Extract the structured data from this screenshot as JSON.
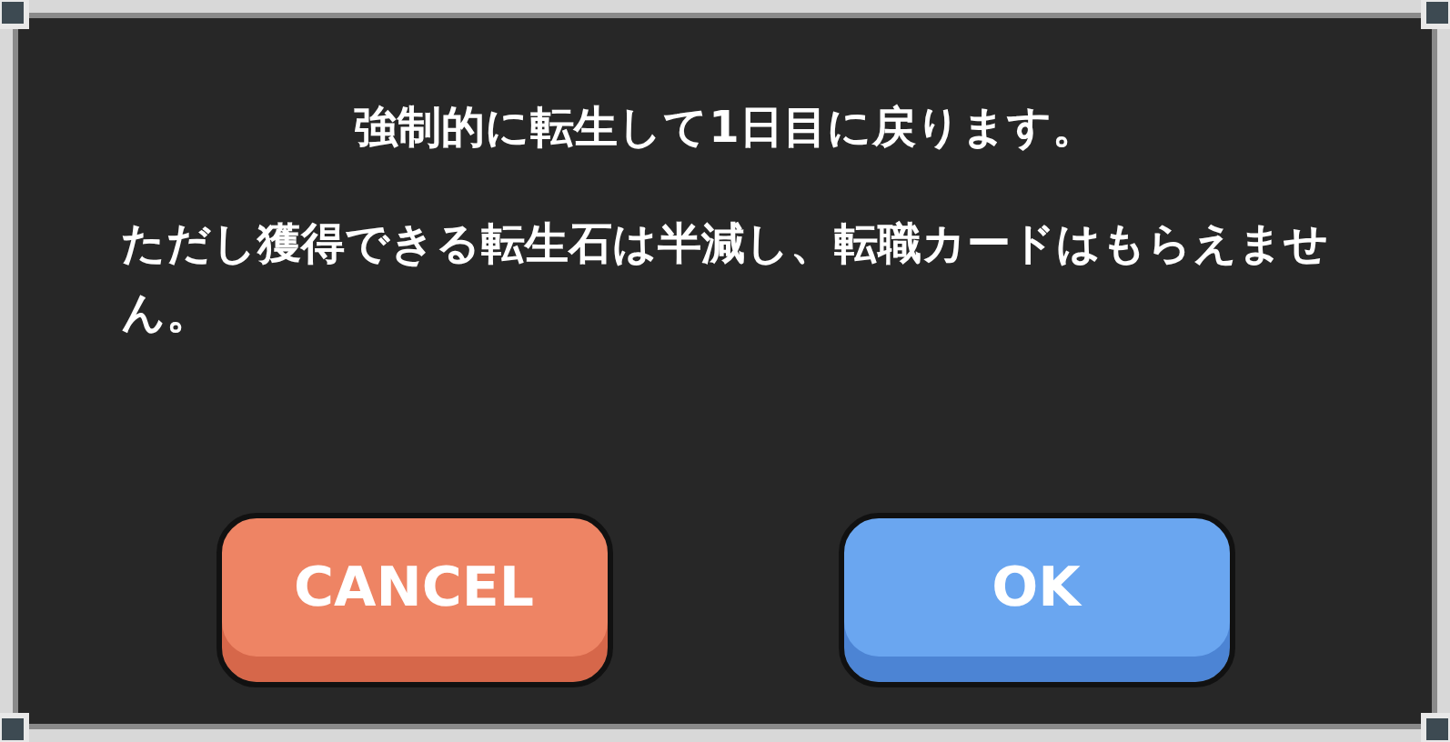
{
  "dialog": {
    "messages": [
      "強制的に転生して1日目に戻ります。",
      "ただし獲得できる転生石は半減し、転職カードはもらえません。"
    ],
    "buttons": [
      {
        "label": "CANCEL",
        "kind": "cancel"
      },
      {
        "label": "OK",
        "kind": "confirm"
      }
    ]
  }
}
